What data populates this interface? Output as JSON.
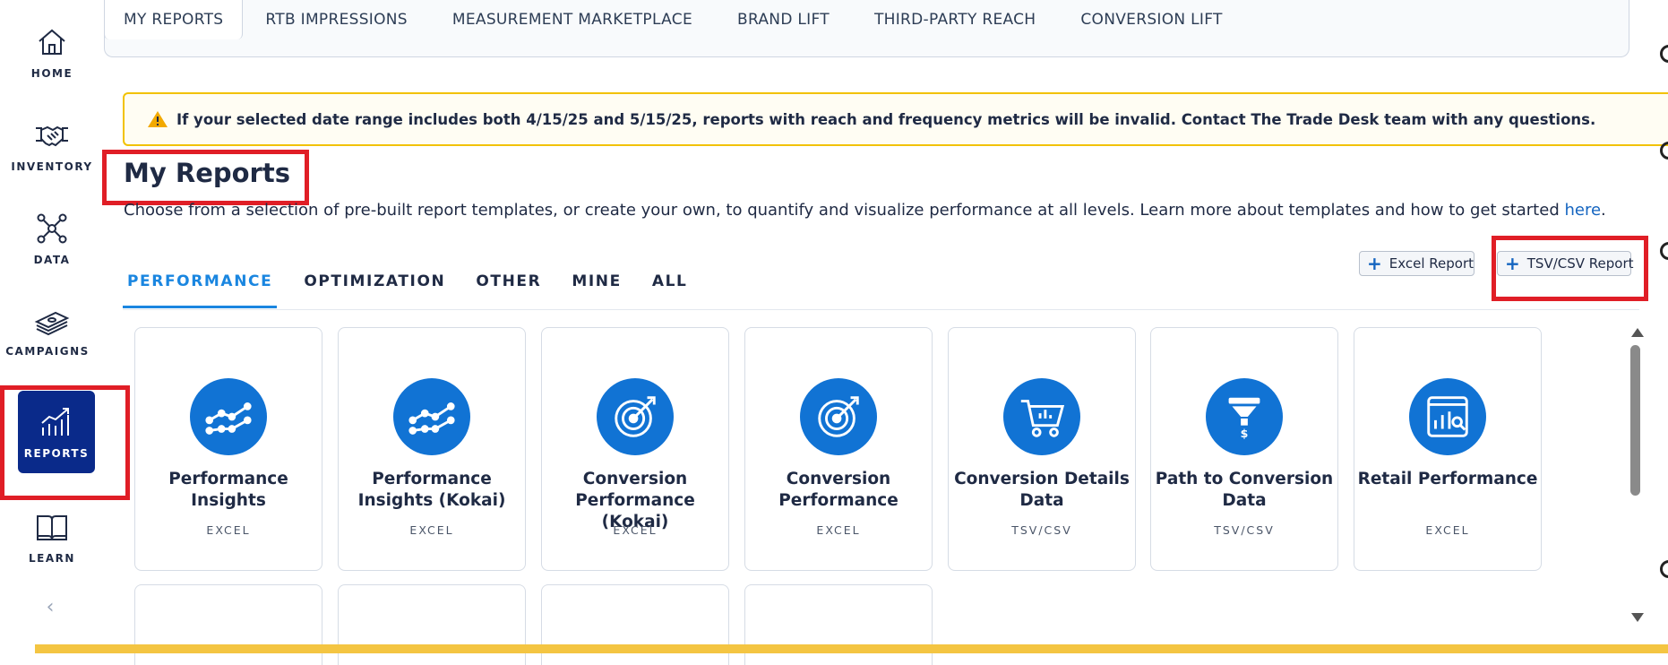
{
  "sidebar": {
    "items": [
      {
        "label": "HOME",
        "icon": "home-icon"
      },
      {
        "label": "INVENTORY",
        "icon": "handshake-icon"
      },
      {
        "label": "DATA",
        "icon": "network-icon"
      },
      {
        "label": "CAMPAIGNS",
        "icon": "money-stack-icon"
      },
      {
        "label": "REPORTS",
        "icon": "bar-chart-icon"
      },
      {
        "label": "LEARN",
        "icon": "book-icon"
      }
    ]
  },
  "top_tabs": [
    "MY REPORTS",
    "RTB IMPRESSIONS",
    "MEASUREMENT MARKETPLACE",
    "BRAND LIFT",
    "THIRD-PARTY REACH",
    "CONVERSION LIFT"
  ],
  "alert": {
    "icon": "warning-icon",
    "message": "If your selected date range includes both 4/15/25 and 5/15/25, reports with reach and frequency metrics will be invalid. Contact The Trade Desk team with any questions."
  },
  "page": {
    "title": "My Reports",
    "description": "Choose from a selection of pre-built report templates, or create your own, to quantify and visualize performance at all levels. Learn more about templates and how to get started ",
    "link_text": "here",
    "description_end": "."
  },
  "category_tabs": [
    "PERFORMANCE",
    "OPTIMIZATION",
    "OTHER",
    "MINE",
    "ALL"
  ],
  "buttons": {
    "excel": "Excel Report",
    "tsv": "TSV/CSV Report"
  },
  "cards": [
    {
      "title": "Performance Insights",
      "type": "EXCEL",
      "icon": "trend-line-icon"
    },
    {
      "title": "Performance Insights (Kokai)",
      "type": "EXCEL",
      "icon": "trend-line-icon"
    },
    {
      "title": "Conversion Performance (Kokai)",
      "type": "EXCEL",
      "icon": "target-icon"
    },
    {
      "title": "Conversion Performance",
      "type": "EXCEL",
      "icon": "target-icon"
    },
    {
      "title": "Conversion Details Data",
      "type": "TSV/CSV",
      "icon": "cart-icon"
    },
    {
      "title": "Path to Conversion Data",
      "type": "TSV/CSV",
      "icon": "funnel-icon"
    },
    {
      "title": "Retail Performance",
      "type": "EXCEL",
      "icon": "dashboard-icon"
    }
  ],
  "colors": {
    "accent": "#1173d4",
    "nav_active": "#0a2a8a",
    "highlight": "#e01e26",
    "alert_border": "#f2c200"
  }
}
